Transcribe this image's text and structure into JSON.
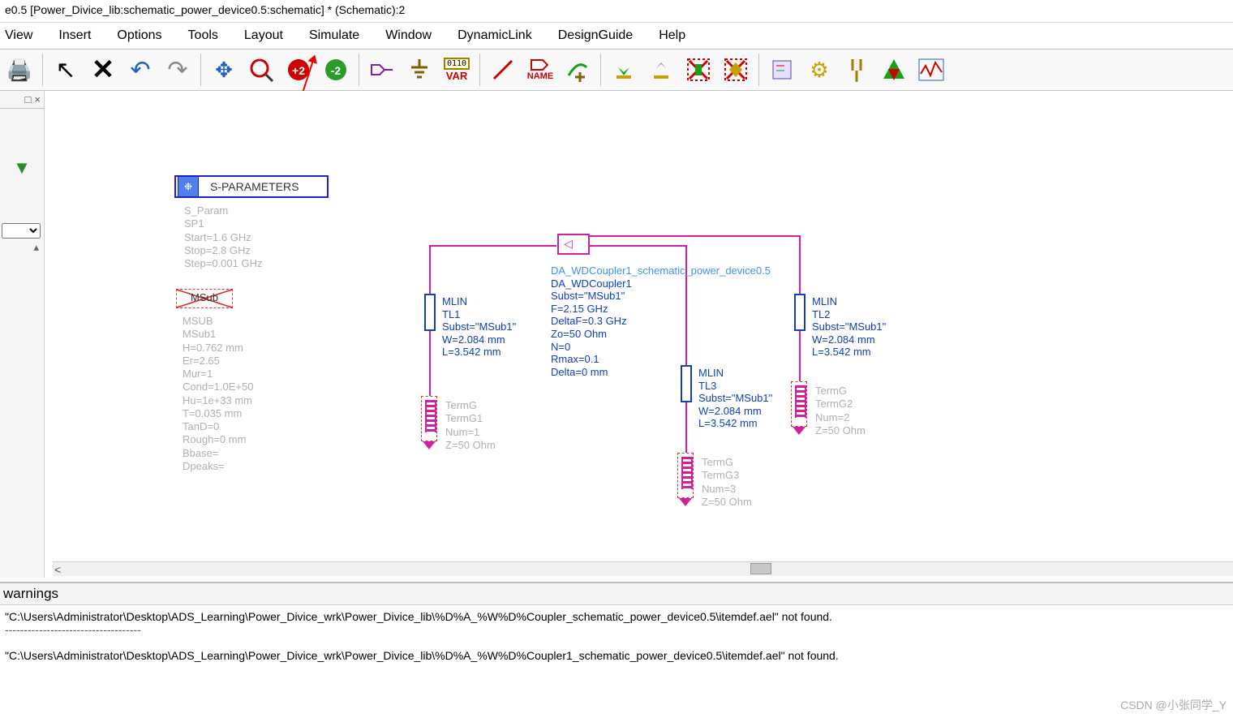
{
  "title": "e0.5 [Power_Divice_lib:schematic_power_device0.5:schematic] * (Schematic):2",
  "menu": {
    "view": "View",
    "insert": "Insert",
    "options": "Options",
    "tools": "Tools",
    "layout": "Layout",
    "simulate": "Simulate",
    "window": "Window",
    "dynamic": "DynamicLink",
    "design": "DesignGuide",
    "help": "Help"
  },
  "toolbar": {
    "name": "NAME",
    "var": "VAR",
    "var_sub": "0110"
  },
  "sparam_box": {
    "label": "S-PARAMETERS"
  },
  "sparam_params": {
    "l1": "S_Param",
    "l2": "SP1",
    "l3": "Start=1.6 GHz",
    "l4": "Stop=2.8 GHz",
    "l5": "Step=0.001 GHz"
  },
  "msub_box": {
    "label": "MSub"
  },
  "msub_params": {
    "l1": "MSUB",
    "l2": "MSub1",
    "l3": "H=0.762 mm",
    "l4": "Er=2.65",
    "l5": "Mur=1",
    "l6": "Cond=1.0E+50",
    "l7": "Hu=1e+33 mm",
    "l8": "T=0.035 mm",
    "l9": "TanD=0",
    "l10": "Rough=0 mm",
    "l11": "Bbase=",
    "l12": "Dpeaks="
  },
  "tl1": {
    "l1": "MLIN",
    "l2": "TL1",
    "l3": "Subst=\"MSub1\"",
    "l4": "W=2.084 mm",
    "l5": "L=3.542 mm"
  },
  "tl2": {
    "l1": "MLIN",
    "l2": "TL2",
    "l3": "Subst=\"MSub1\"",
    "l4": "W=2.084 mm",
    "l5": "L=3.542 mm"
  },
  "tl3": {
    "l1": "MLIN",
    "l2": "TL3",
    "l3": "Subst=\"MSub1\"",
    "l4": "W=2.084 mm",
    "l5": "L=3.542 mm"
  },
  "coupler": {
    "l1": "DA_WDCoupler1_schematic_power_device0.5",
    "l2": "DA_WDCoupler1",
    "l3": "Subst=\"MSub1\"",
    "l4": "F=2.15 GHz",
    "l5": "DeltaF=0.3 GHz",
    "l6": "Zo=50 Ohm",
    "l7": "N=0",
    "l8": "Rmax=0.1",
    "l9": "Delta=0 mm"
  },
  "term1": {
    "l1": "TermG",
    "l2": "TermG1",
    "l3": "Num=1",
    "l4": "Z=50 Ohm"
  },
  "term2": {
    "l1": "TermG",
    "l2": "TermG2",
    "l3": "Num=2",
    "l4": "Z=50 Ohm"
  },
  "term3": {
    "l1": "TermG",
    "l2": "TermG3",
    "l3": "Num=3",
    "l4": "Z=50 Ohm"
  },
  "warnings": {
    "header": "warnings",
    "line1": "\"C:\\Users\\Administrator\\Desktop\\ADS_Learning\\Power_Divice_wrk\\Power_Divice_lib\\%D%A_%W%D%Coupler_schematic_power_device0.5\\itemdef.ael\" not found.",
    "sep": "------------------------------------",
    "line2": "\"C:\\Users\\Administrator\\Desktop\\ADS_Learning\\Power_Divice_wrk\\Power_Divice_lib\\%D%A_%W%D%Coupler1_schematic_power_device0.5\\itemdef.ael\" not found."
  },
  "watermark": "CSDN @小张同学_Y",
  "sideclose": "×",
  "sidepin": "□"
}
